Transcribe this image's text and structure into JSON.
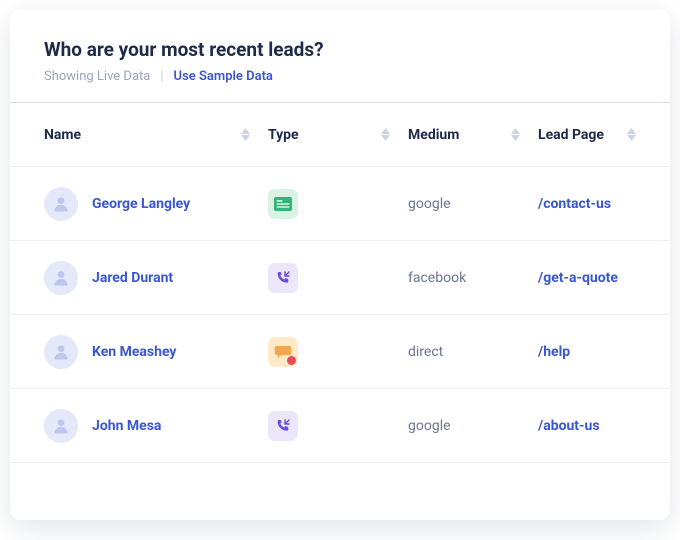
{
  "header": {
    "title": "Who are your most recent leads?",
    "live_label": "Showing Live Data",
    "separator": "|",
    "sample_link": "Use Sample Data"
  },
  "columns": {
    "name": "Name",
    "type": "Type",
    "medium": "Medium",
    "lead_page": "Lead Page"
  },
  "rows": [
    {
      "name": "George Langley",
      "type": "form",
      "medium": "google",
      "lead_page": "/contact-us"
    },
    {
      "name": "Jared Durant",
      "type": "call",
      "medium": "facebook",
      "lead_page": "/get-a-quote"
    },
    {
      "name": "Ken Meashey",
      "type": "chat",
      "medium": "direct",
      "lead_page": "/help"
    },
    {
      "name": "John Mesa",
      "type": "call",
      "medium": "google",
      "lead_page": "/about-us"
    }
  ],
  "icons": {
    "avatar": "person-icon",
    "form": "form-icon",
    "call": "phone-incoming-icon",
    "chat": "chat-bubble-icon",
    "sort": "sort-arrows-icon"
  }
}
